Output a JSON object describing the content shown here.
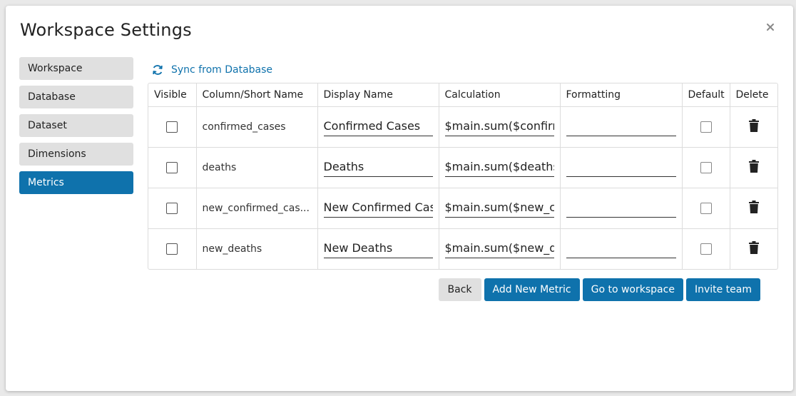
{
  "modal": {
    "title": "Workspace Settings"
  },
  "nav": {
    "items": [
      {
        "label": "Workspace",
        "active": false
      },
      {
        "label": "Database",
        "active": false
      },
      {
        "label": "Dataset",
        "active": false
      },
      {
        "label": "Dimensions",
        "active": false
      },
      {
        "label": "Metrics",
        "active": true
      }
    ]
  },
  "sync": {
    "label": "Sync from Database",
    "icon": "sync-icon"
  },
  "table": {
    "headers": [
      "Visible",
      "Column/Short Name",
      "Display Name",
      "Calculation",
      "Formatting",
      "Default",
      "Delete"
    ],
    "rows": [
      {
        "visible": false,
        "short_name": "confirmed_cases",
        "display_name": "Confirmed Cases",
        "calculation": "$main.sum($confirmed_cases)",
        "formatting": "",
        "default": false
      },
      {
        "visible": false,
        "short_name": "deaths",
        "display_name": "Deaths",
        "calculation": "$main.sum($deaths)",
        "formatting": "",
        "default": false
      },
      {
        "visible": false,
        "short_name": "new_confirmed_cas...",
        "display_name": "New Confirmed Cases",
        "calculation": "$main.sum($new_confirmed_cases)",
        "formatting": "",
        "default": false
      },
      {
        "visible": false,
        "short_name": "new_deaths",
        "display_name": "New Deaths",
        "calculation": "$main.sum($new_deaths)",
        "formatting": "",
        "default": false
      }
    ]
  },
  "footer": {
    "back_label": "Back",
    "add_label": "Add New Metric",
    "workspace_label": "Go to workspace",
    "invite_label": "Invite team"
  },
  "colors": {
    "accent": "#0f72ac",
    "nav_inactive": "#e0e0e0"
  }
}
